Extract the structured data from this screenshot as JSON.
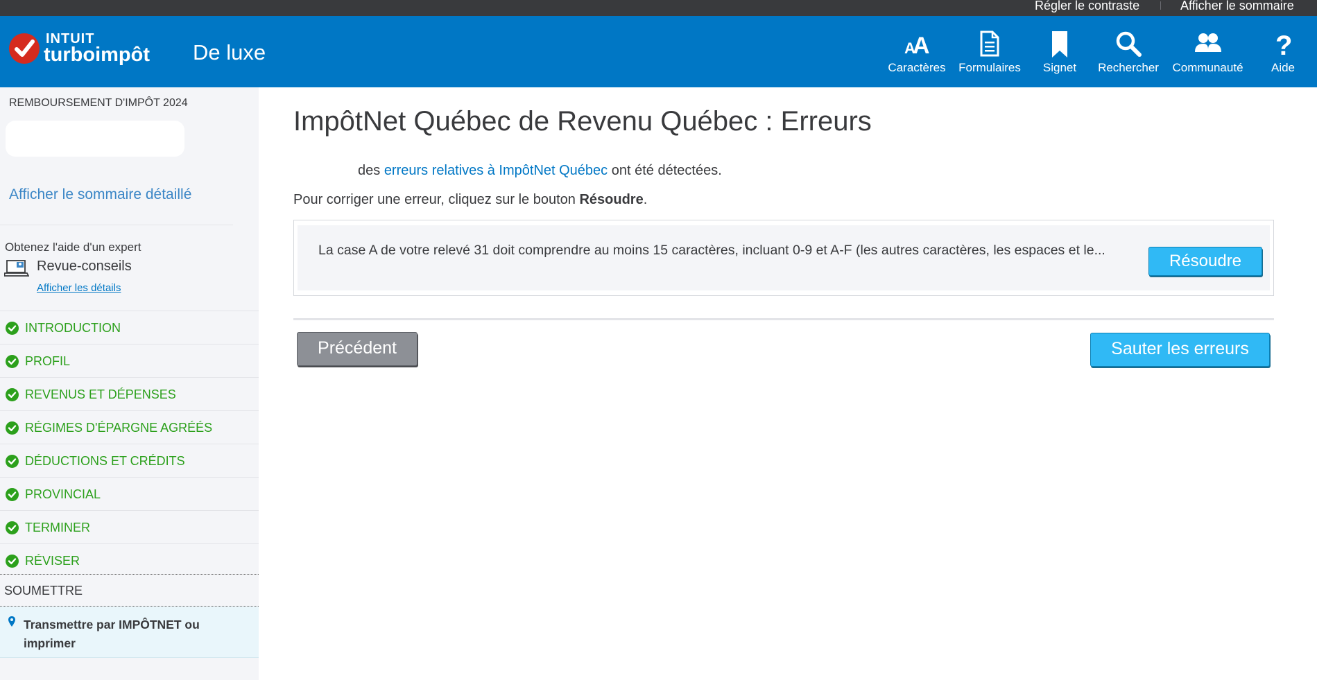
{
  "utility_bar": {
    "contrast": "Régler le contraste",
    "summary": "Afficher le sommaire"
  },
  "header": {
    "logo_brand": "INTUIT",
    "logo_product": "turboimpôt",
    "edition": "De luxe",
    "nav": [
      {
        "label": "Caractères",
        "icon": "text-size-icon"
      },
      {
        "label": "Formulaires",
        "icon": "forms-icon"
      },
      {
        "label": "Signet",
        "icon": "bookmark-icon"
      },
      {
        "label": "Rechercher",
        "icon": "search-icon"
      },
      {
        "label": "Communauté",
        "icon": "community-icon"
      },
      {
        "label": "Aide",
        "icon": "help-icon"
      }
    ]
  },
  "sidebar": {
    "refund_label": "REMBOURSEMENT D'IMPÔT 2024",
    "detailed_summary_link": "Afficher le sommaire détaillé",
    "expert_help": "Obtenez l'aide d'un expert",
    "review_label": "Revue-conseils",
    "details_link": "Afficher les détails",
    "sections": [
      {
        "label": "INTRODUCTION",
        "status": "complete"
      },
      {
        "label": "PROFIL",
        "status": "complete"
      },
      {
        "label": "REVENUS ET DÉPENSES",
        "status": "complete"
      },
      {
        "label": "RÉGIMES D'ÉPARGNE AGRÉÉS",
        "status": "complete"
      },
      {
        "label": "DÉDUCTIONS ET CRÉDITS",
        "status": "complete"
      },
      {
        "label": "PROVINCIAL",
        "status": "complete"
      },
      {
        "label": "TERMINER",
        "status": "complete"
      },
      {
        "label": "RÉVISER",
        "status": "complete"
      }
    ],
    "submit_section": "SOUMETTRE",
    "current_step": "Transmettre par IMPÔTNET ou imprimer"
  },
  "main": {
    "title": "ImpôtNet Québec de Revenu Québec : Erreurs",
    "intro_prefix": "des ",
    "intro_link": "erreurs relatives à ImpôtNet Québec",
    "intro_suffix": " ont été détectées.",
    "instruction_prefix": "Pour corriger une erreur, cliquez sur le bouton ",
    "instruction_bold": "Résoudre",
    "instruction_suffix": ".",
    "errors": [
      {
        "text": "La case A de votre relevé 31 doit comprendre au moins 15 caractères, incluant 0-9 et A-F (les autres caractères, les espaces et le...",
        "action": "Résoudre"
      }
    ],
    "back_button": "Précédent",
    "skip_button": "Sauter les erreurs"
  },
  "colors": {
    "header_blue": "#0077c5",
    "utility_bar": "#393a3d",
    "check_green": "#2ca01c",
    "button_blue": "#30b9f5",
    "button_gray": "#8d9096",
    "logo_red": "#d52b1e"
  }
}
